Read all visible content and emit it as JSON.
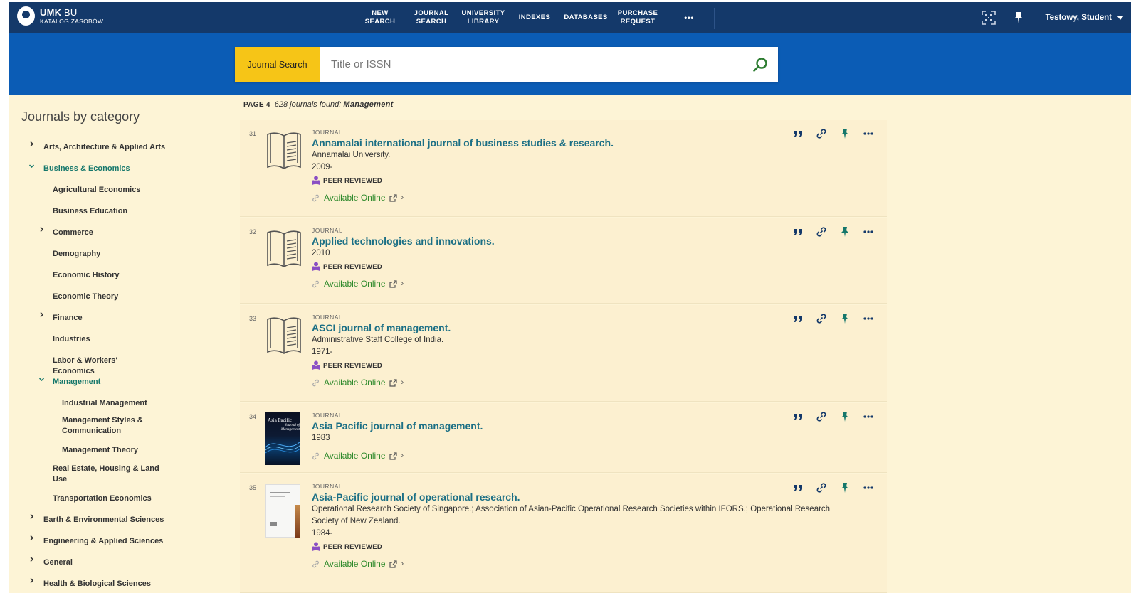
{
  "brand": {
    "title_bold": "UMK",
    "title_rest": " BU",
    "subtitle": "KATALOG ZASOBÓW"
  },
  "nav": [
    {
      "line1": "NEW",
      "line2": "SEARCH"
    },
    {
      "line1": "JOURNAL",
      "line2": "SEARCH"
    },
    {
      "line1": "UNIVERSITY",
      "line2": "LIBRARY"
    },
    {
      "line1": "INDEXES",
      "line2": ""
    },
    {
      "line1": "DATABASES",
      "line2": ""
    },
    {
      "line1": "PURCHASE",
      "line2": "REQUEST"
    },
    {
      "line1": "•••",
      "line2": ""
    }
  ],
  "user": {
    "name": "Testowy, Student"
  },
  "search": {
    "scope": "Journal Search",
    "placeholder": "Title or ISSN",
    "value": ""
  },
  "sidebar": {
    "title": "Journals by category",
    "items": [
      {
        "label": "Arts, Architecture & Applied Arts",
        "level": 0,
        "expander": "right",
        "active": false
      },
      {
        "label": "Business & Economics",
        "level": 0,
        "expander": "down",
        "active": true
      },
      {
        "label": "Agricultural Economics",
        "level": 1,
        "expander": "",
        "active": false
      },
      {
        "label": "Business Education",
        "level": 1,
        "expander": "",
        "active": false
      },
      {
        "label": "Commerce",
        "level": 1,
        "expander": "right",
        "active": false
      },
      {
        "label": "Demography",
        "level": 1,
        "expander": "",
        "active": false
      },
      {
        "label": "Economic History",
        "level": 1,
        "expander": "",
        "active": false
      },
      {
        "label": "Economic Theory",
        "level": 1,
        "expander": "",
        "active": false
      },
      {
        "label": "Finance",
        "level": 1,
        "expander": "right",
        "active": false
      },
      {
        "label": "Industries",
        "level": 1,
        "expander": "",
        "active": false
      },
      {
        "label": "Labor & Workers' Economics",
        "level": 1,
        "expander": "",
        "active": false
      },
      {
        "label": "Management",
        "level": 1,
        "expander": "down",
        "active": true
      },
      {
        "label": "Industrial Management",
        "level": 2,
        "expander": "",
        "active": false
      },
      {
        "label": "Management Styles & Communication",
        "level": 2,
        "expander": "",
        "active": false
      },
      {
        "label": "Management Theory",
        "level": 2,
        "expander": "",
        "active": false
      },
      {
        "label": "Real Estate, Housing & Land Use",
        "level": 1,
        "expander": "",
        "active": false
      },
      {
        "label": "Transportation Economics",
        "level": 1,
        "expander": "",
        "active": false
      },
      {
        "label": "Earth & Environmental Sciences",
        "level": 0,
        "expander": "right",
        "active": false
      },
      {
        "label": "Engineering & Applied Sciences",
        "level": 0,
        "expander": "right",
        "active": false
      },
      {
        "label": "General",
        "level": 0,
        "expander": "right",
        "active": false
      },
      {
        "label": "Health & Biological Sciences",
        "level": 0,
        "expander": "right",
        "active": false
      }
    ]
  },
  "results": {
    "page_label": "PAGE 4",
    "count_text": "628 journals found:",
    "query": "Management",
    "items": [
      {
        "num": "31",
        "type": "JOURNAL",
        "title": "Annamalai international journal of business studies & research.",
        "publisher": "Annamalai University.",
        "date": "2009-",
        "peer_reviewed": "PEER REVIEWED",
        "availability": "Available Online",
        "thumb": "book-icon"
      },
      {
        "num": "32",
        "type": "JOURNAL",
        "title": "Applied technologies and innovations.",
        "publisher": "",
        "date": "2010",
        "peer_reviewed": "PEER REVIEWED",
        "availability": "Available Online",
        "thumb": "book-icon"
      },
      {
        "num": "33",
        "type": "JOURNAL",
        "title": "ASCI journal of management.",
        "publisher": "Administrative Staff College of India.",
        "date": "1971-",
        "peer_reviewed": "PEER REVIEWED",
        "availability": "Available Online",
        "thumb": "book-icon"
      },
      {
        "num": "34",
        "type": "JOURNAL",
        "title": "Asia Pacific journal of management.",
        "publisher": "",
        "date": "1983",
        "peer_reviewed": "",
        "availability": "Available Online",
        "thumb": "cover-dark",
        "cover_title": "Asia Pacific",
        "cover_sub": "Journal of Management"
      },
      {
        "num": "35",
        "type": "JOURNAL",
        "title": "Asia-Pacific journal of operational research.",
        "publisher": "Operational Research Society of Singapore.; Association of Asian-Pacific Operational Research Societies within IFORS.; Operational Research Society of New Zealand.",
        "date": "1984-",
        "peer_reviewed": "PEER REVIEWED",
        "availability": "Available Online",
        "thumb": "cover-light"
      }
    ]
  },
  "colors": {
    "nav": "#14396a",
    "search_band": "#0b5cb5",
    "scope": "#f6c517",
    "background": "#fdf4d6",
    "title_link": "#1b6f85",
    "active": "#15776b",
    "available": "#2f8a2c",
    "peer_badge": "#8a4fc4"
  }
}
